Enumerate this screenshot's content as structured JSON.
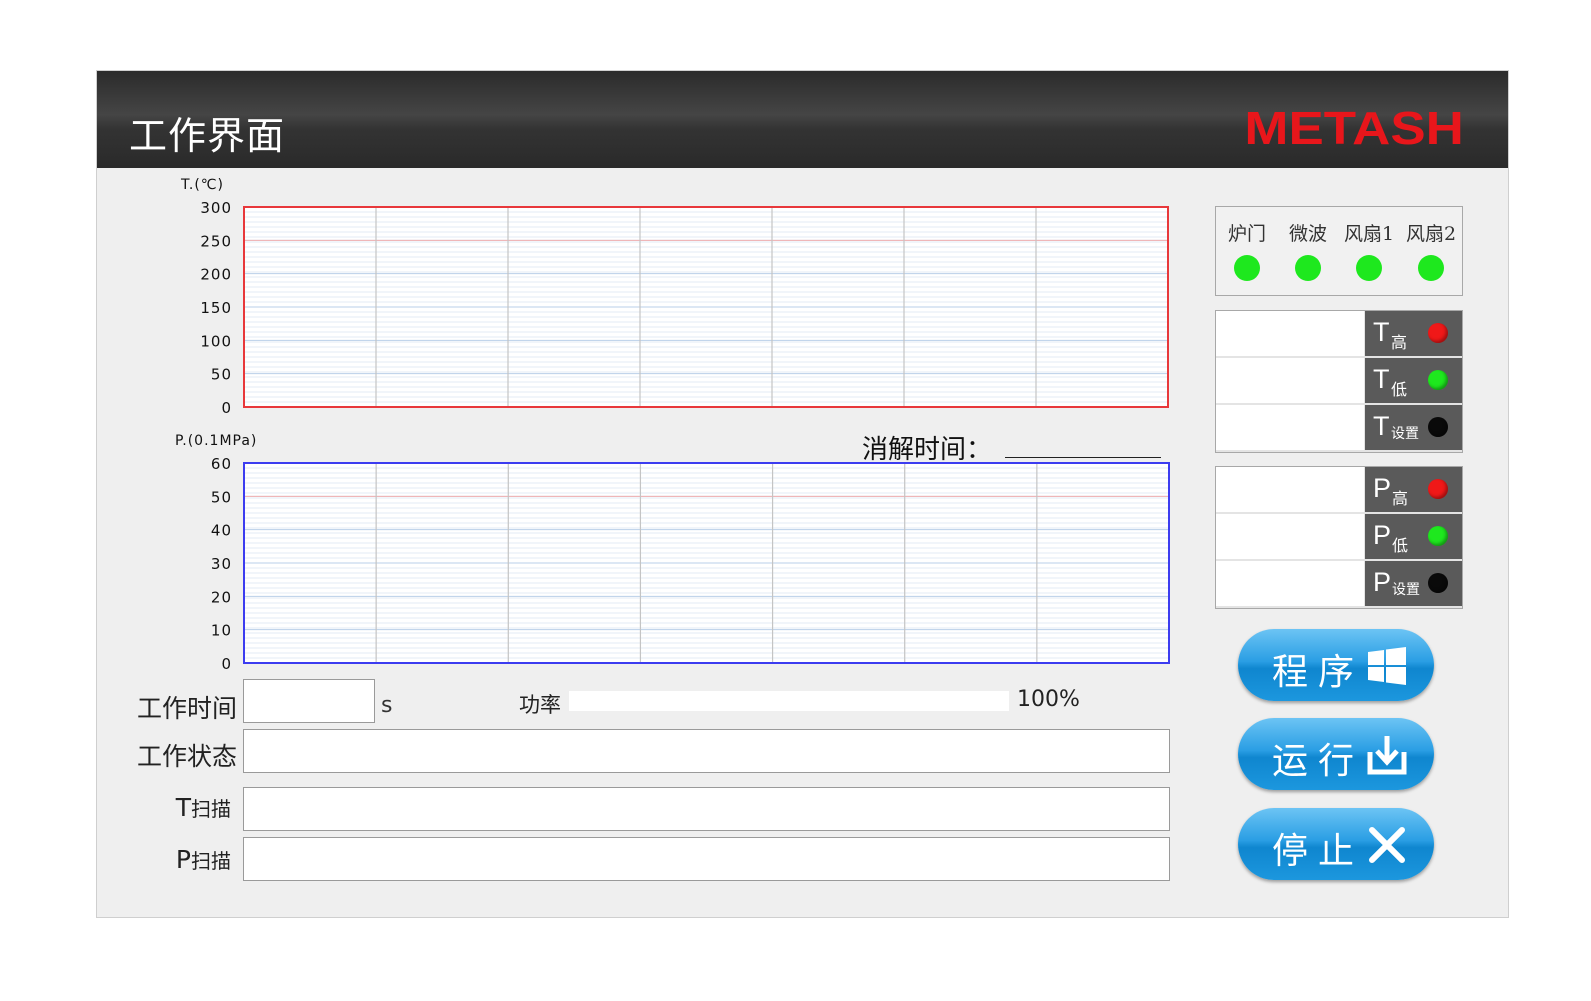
{
  "header": {
    "title": "工作界面",
    "brand": "METASH",
    "brand_color": "#e8161b"
  },
  "temperature_chart": {
    "axis_title": "T.(℃)",
    "ticks": [
      "300",
      "250",
      "200",
      "150",
      "100",
      "50",
      "0"
    ],
    "border_color": "#e8383b"
  },
  "pressure_chart": {
    "axis_title": "P.(0.1MPa)",
    "ticks": [
      "60",
      "50",
      "40",
      "30",
      "20",
      "10",
      "0"
    ],
    "border_color": "#3c3cf0"
  },
  "chart_data": [
    {
      "type": "line",
      "ylabel": "T.(℃)",
      "ylim": [
        0,
        300
      ],
      "yticks": [
        0,
        50,
        100,
        150,
        200,
        250,
        300
      ],
      "series": [],
      "grid": true
    },
    {
      "type": "line",
      "ylabel": "P.(0.1MPa)",
      "ylim": [
        0,
        60
      ],
      "yticks": [
        0,
        10,
        20,
        30,
        40,
        50,
        60
      ],
      "series": [],
      "grid": true
    }
  ],
  "digest": {
    "label": "消解时间："
  },
  "fields": {
    "work_time": {
      "label": "工作时间",
      "value": "",
      "unit": "s"
    },
    "work_status": {
      "label": "工作状态",
      "value": ""
    },
    "t_scan": {
      "main": "T",
      "sub": "扫描",
      "value": ""
    },
    "p_scan": {
      "main": "P",
      "sub": "扫描",
      "value": ""
    }
  },
  "power": {
    "label": "功率",
    "max_label": "100%",
    "level_percent": 0
  },
  "status": [
    {
      "label": "炉门",
      "color": "#1ee81e"
    },
    {
      "label": "微波",
      "color": "#1ee81e"
    },
    {
      "label": "风扇1",
      "color": "#1ee81e"
    },
    {
      "label": "风扇2",
      "color": "#1ee81e"
    }
  ],
  "temperature_params": [
    {
      "main": "T",
      "sub": "高",
      "value": "",
      "led": "#f01818"
    },
    {
      "main": "T",
      "sub": "低",
      "value": "",
      "led": "#1ee81e"
    },
    {
      "main": "T",
      "sub": "设置",
      "value": "",
      "led": "#0a0a0a"
    }
  ],
  "pressure_params": [
    {
      "main": "P",
      "sub": "高",
      "value": "",
      "led": "#f01818"
    },
    {
      "main": "P",
      "sub": "低",
      "value": "",
      "led": "#1ee81e"
    },
    {
      "main": "P",
      "sub": "设置",
      "value": "",
      "led": "#0a0a0a"
    }
  ],
  "buttons": {
    "program": "程序",
    "run": "运行",
    "stop": "停止"
  }
}
